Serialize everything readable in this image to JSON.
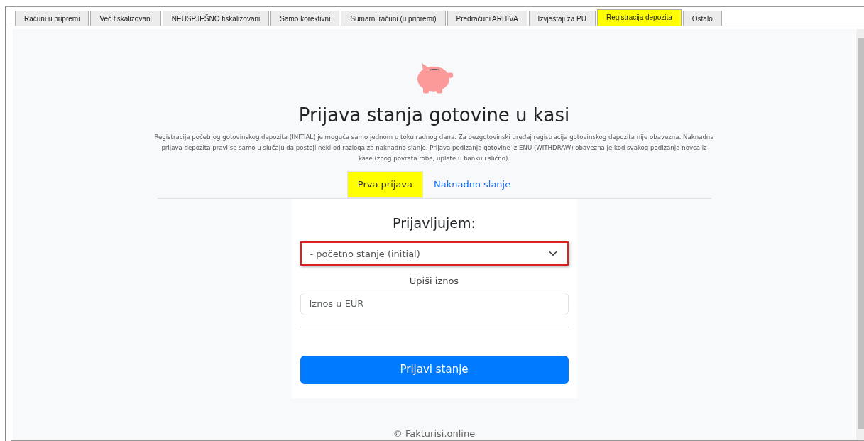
{
  "tabs": [
    {
      "label": "Računi u pripremi",
      "selected": false
    },
    {
      "label": "Već fiskalizovani",
      "selected": false
    },
    {
      "label": "NEUSPJEŠNO fiskalizovani",
      "selected": false
    },
    {
      "label": "Samo korektivni",
      "selected": false
    },
    {
      "label": "Sumarni računi (u pripremi)",
      "selected": false
    },
    {
      "label": "Predračuni ARHIVA",
      "selected": false
    },
    {
      "label": "Izvještaji za PU",
      "selected": false
    },
    {
      "label": "Registracija depozita",
      "selected": true
    },
    {
      "label": "Ostalo",
      "selected": false
    }
  ],
  "page": {
    "title": "Prijava stanja gotovine u kasi",
    "description": "Registracija početnog gotovinskog depozita (INITIAL) je moguća samo jednom u toku radnog dana. Za bezgotovinski uređaj registracija gotovinskog depozita nije obavezna. Naknadna prijava depozita pravi se samo u slučaju da postoji neki od razloga za naknadno slanje. Prijava podizanja gotovine iz ENU (WITHDRAW) obavezna je kod svakog podizanja novca iz kase (zbog povrata robe, uplate u banku i slično).",
    "sub_tabs": [
      {
        "label": "Prva prijava",
        "selected": true
      },
      {
        "label": "Naknadno slanje",
        "selected": false
      }
    ]
  },
  "form": {
    "heading": "Prijavljujem:",
    "select_value": "- početno stanje (initial)",
    "amount_label": "Upiši iznos",
    "amount_placeholder": "Iznos u EUR",
    "submit": "Prijavi stanje"
  },
  "footer": "© Fakturisi.online"
}
